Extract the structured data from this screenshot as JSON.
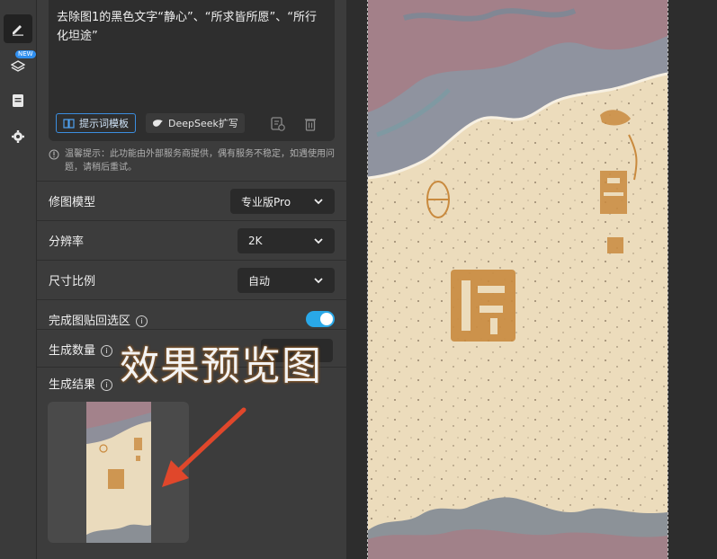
{
  "toolbar": {
    "icons": [
      "pencil-icon",
      "layers-icon",
      "document-icon",
      "gear-icon"
    ],
    "new_badge": "NEW"
  },
  "prompt": {
    "text": "去除图1的黑色文字“静心”、“所求皆所愿”、“所行化坦途”",
    "template_button": "提示词模板",
    "deepseek_button": "DeepSeek扩写"
  },
  "tip": {
    "text": "温馨提示：此功能由外部服务商提供，偶有服务不稳定，如遇使用问题，请稍后重试。"
  },
  "settings": {
    "model_label": "修图模型",
    "model_value": "专业版Pro",
    "resolution_label": "分辨率",
    "resolution_value": "2K",
    "ratio_label": "尺寸比例",
    "ratio_value": "自动",
    "paste_back_label": "完成图贴回选区",
    "paste_back_on": true,
    "count_label": "生成数量",
    "result_label": "生成结果"
  },
  "annotation": {
    "text": "效果预览图",
    "color": "#e0472b"
  },
  "colors": {
    "accent": "#29a8e8",
    "panel": "#3c3c3c",
    "poster_paper": "#ecdcbc",
    "stamp": "#c98a3e"
  }
}
